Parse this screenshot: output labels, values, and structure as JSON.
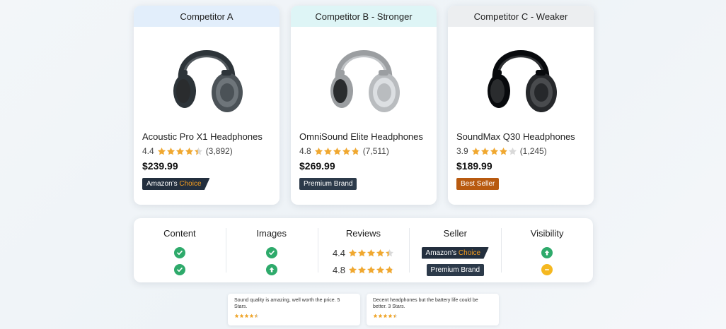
{
  "competitors": [
    {
      "header": "Competitor A",
      "header_color": "#e2eefb",
      "product_name": "Acoustic Pro X1 Headphones",
      "rating": "4.4",
      "stars": 4.4,
      "review_count": "(3,892)",
      "price": "$239.99",
      "badge_type": "amazon",
      "badge_main": "Amazon's",
      "badge_accent": "Choice",
      "image": "headphones-dark-gray-icon",
      "headphone_color": "#4b5257"
    },
    {
      "header": "Competitor B - Stronger",
      "header_color": "#def5f6",
      "product_name": "OmniSound Elite Headphones",
      "rating": "4.8",
      "stars": 4.8,
      "review_count": "(7,511)",
      "price": "$269.99",
      "badge_type": "premium",
      "badge_main": "Premium Brand",
      "image": "headphones-silver-icon",
      "headphone_color": "#b9bcbf"
    },
    {
      "header": "Competitor C - Weaker",
      "header_color": "#eceef0",
      "product_name": "SoundMax Q30 Headphones",
      "rating": "3.9",
      "stars": 3.9,
      "review_count": "(1,245)",
      "price": "$189.99",
      "badge_type": "best",
      "badge_main": "Best Seller",
      "image": "headphones-black-icon",
      "headphone_color": "#26282b"
    }
  ],
  "comparison": {
    "columns": [
      {
        "title": "Content",
        "rows": [
          {
            "type": "check"
          },
          {
            "type": "check"
          }
        ]
      },
      {
        "title": "Images",
        "rows": [
          {
            "type": "check"
          },
          {
            "type": "up"
          }
        ]
      },
      {
        "title": "Reviews",
        "rows": [
          {
            "type": "rating",
            "value": "4.4",
            "stars": 4.4
          },
          {
            "type": "rating",
            "value": "4.8",
            "stars": 4.8
          }
        ]
      },
      {
        "title": "Seller",
        "rows": [
          {
            "type": "amazon",
            "main": "Amazon's",
            "accent": "Choice"
          },
          {
            "type": "premium",
            "main": "Premium Brand"
          }
        ]
      },
      {
        "title": "Visibility",
        "rows": [
          {
            "type": "up"
          },
          {
            "type": "neutral"
          }
        ]
      }
    ]
  },
  "reviews": [
    {
      "text": "Sound quality is amazing, well worth the price. 5 Stars.",
      "stars": 4.5
    },
    {
      "text": "Decent headphones but the battery life could be better. 3 Stars.",
      "stars": 4.5
    }
  ],
  "colors": {
    "star": "#f0a830",
    "star_empty": "#d9d9d9",
    "check": "#2eaa6b",
    "up": "#2eaa6b",
    "neutral": "#f5b820"
  }
}
